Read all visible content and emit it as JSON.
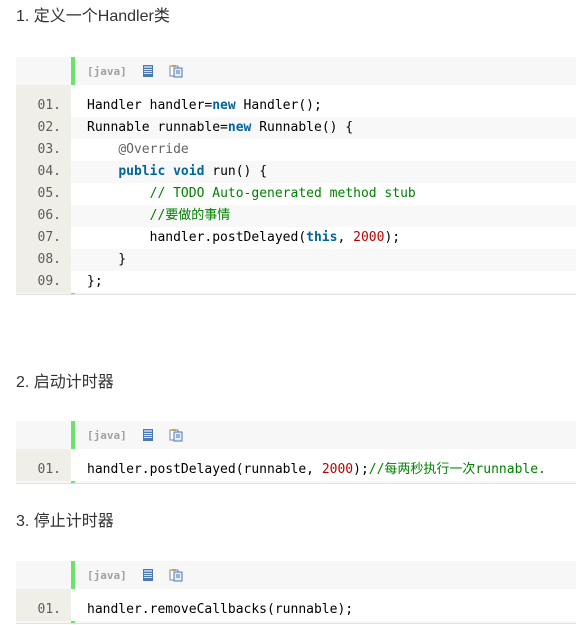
{
  "sections": [
    {
      "heading": "1. 定义一个Handler类"
    },
    {
      "heading": "2. 启动计时器"
    },
    {
      "heading": "3. 停止计时器"
    }
  ],
  "toolbar": {
    "lang_tag": "[java]",
    "view_plain_icon": "view-plain-icon",
    "copy_icon": "copy-icon"
  },
  "block1": {
    "line_numbers": [
      "01.",
      "02.",
      "03.",
      "04.",
      "05.",
      "06.",
      "07.",
      "08.",
      "09."
    ],
    "l1": {
      "a": "Handler handler=",
      "b": "new",
      "c": " Handler();"
    },
    "l2": {
      "a": "Runnable runnable=",
      "b": "new",
      "c": " Runnable() {"
    },
    "l3": {
      "a": "    ",
      "b": "@Override"
    },
    "l4": {
      "a": "    ",
      "b": "public",
      "c": " ",
      "d": "void",
      "e": " run() {"
    },
    "l5": {
      "a": "        ",
      "b": "// TODO Auto-generated method stub"
    },
    "l6": {
      "a": "        ",
      "b": "//要做的事情"
    },
    "l7": {
      "a": "        handler.postDelayed(",
      "b": "this",
      "c": ", ",
      "d": "2000",
      "e": ");"
    },
    "l8": {
      "a": "    }"
    },
    "l9": {
      "a": "};"
    }
  },
  "block2": {
    "line_numbers": [
      "01."
    ],
    "l1": {
      "a": "handler.postDelayed(runnable, ",
      "b": "2000",
      "c": ");",
      "d": "//每两秒执行一次runnable."
    }
  },
  "block3": {
    "line_numbers": [
      "01."
    ],
    "l1": {
      "a": "handler.removeCallbacks(runnable);"
    }
  }
}
